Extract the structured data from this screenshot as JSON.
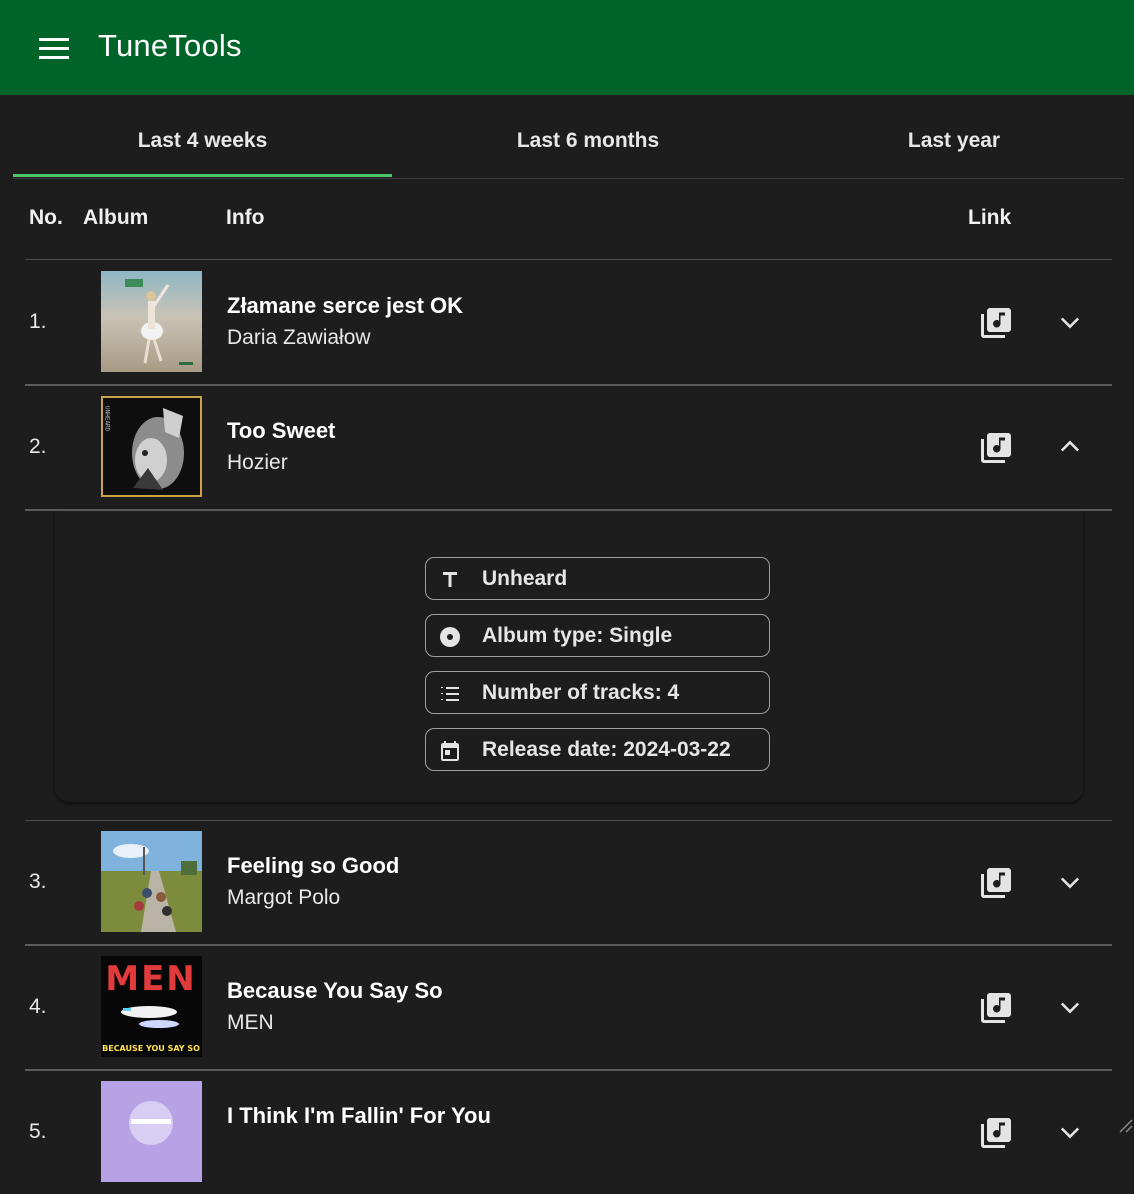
{
  "app": {
    "title": "TuneTools"
  },
  "tabs": [
    {
      "label": "Last 4 weeks",
      "active": true
    },
    {
      "label": "Last 6 months",
      "active": false
    },
    {
      "label": "Last year",
      "active": false
    }
  ],
  "table": {
    "headers": {
      "no": "No.",
      "album": "Album",
      "info": "Info",
      "link": "Link"
    },
    "rows": [
      {
        "num": "1.",
        "title": "Złamane serce jest OK",
        "artist": "Daria Zawiałow",
        "expanded": false
      },
      {
        "num": "2.",
        "title": "Too Sweet",
        "artist": "Hozier",
        "expanded": true
      },
      {
        "num": "3.",
        "title": "Feeling so Good",
        "artist": "Margot Polo",
        "expanded": false
      },
      {
        "num": "4.",
        "title": "Because You Say So",
        "artist": "MEN",
        "expanded": false
      },
      {
        "num": "5.",
        "title": "I Think I'm Fallin' For You",
        "artist": "",
        "expanded": false
      }
    ]
  },
  "details": {
    "album_name": "Unheard",
    "album_type": "Album type: Single",
    "tracks": "Number of tracks: 4",
    "release": "Release date: 2024-03-22"
  },
  "covers": {
    "row2_text": "UNHEARD",
    "row4_logo": "MEN",
    "row4_caption": "BECAUSE YOU SAY SO"
  },
  "colors": {
    "appbar": "#006428",
    "background": "#1c1d1c",
    "tab_indicator": "#4cc46a"
  }
}
